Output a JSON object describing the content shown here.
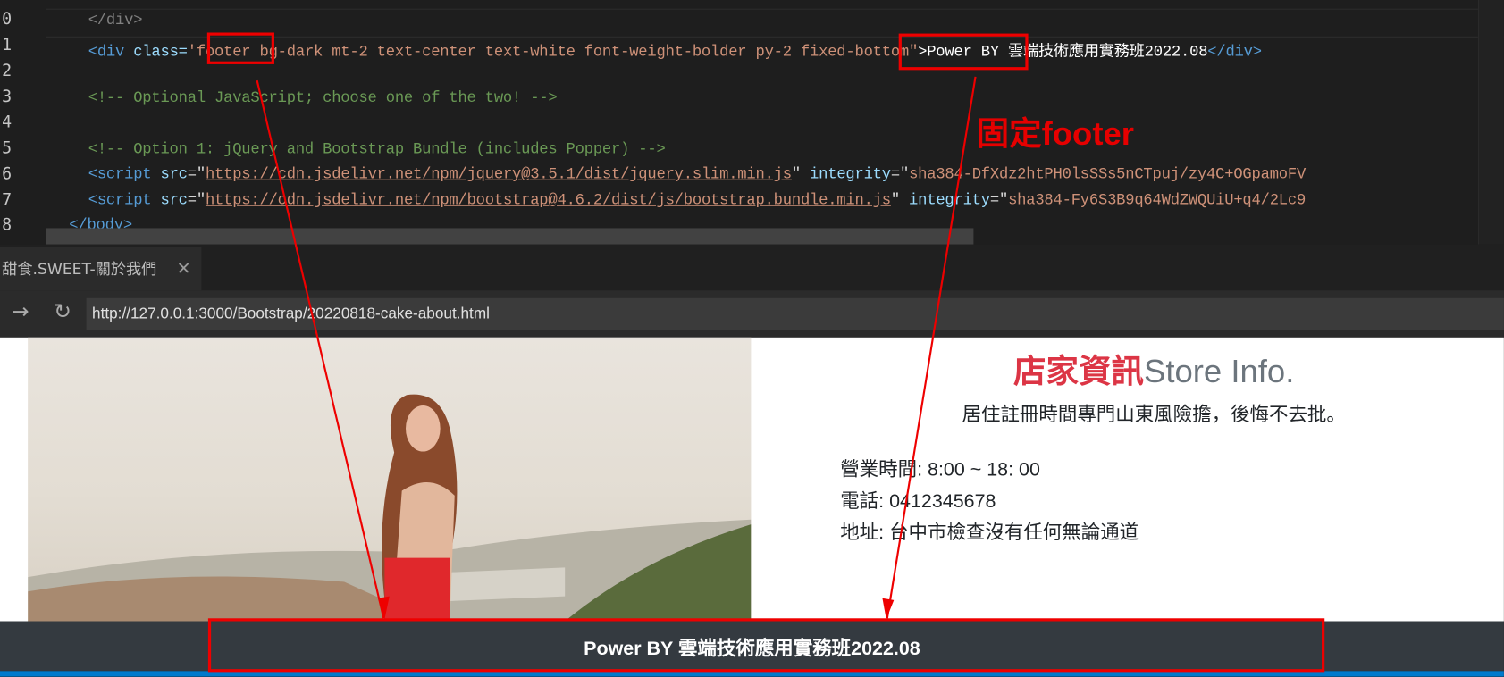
{
  "editor": {
    "line_numbers": [
      "0",
      "1",
      "2",
      "3",
      "4",
      "5",
      "6",
      "7",
      "8"
    ],
    "lines": {
      "l0": "</div>",
      "l1_open": "<div ",
      "l1_attr": "class=",
      "l1_val": "'footer bg-dark mt-2 text-center text-white font-weight-bolder py-2 fixed-bottom\"",
      "l1_text": ">Power BY 雲端技術應用實務班2022.08",
      "l1_close": "</div>",
      "l3": "<!-- Optional JavaScript; choose one of the two! -->",
      "l5": "<!-- Option 1: jQuery and Bootstrap Bundle (includes Popper) -->",
      "l6_src": "https://cdn.jsdelivr.net/npm/jquery@3.5.1/dist/jquery.slim.min.js",
      "l6_int": "sha384-DfXdz2htPH0lsSSs5nCTpuj/zy4C+OGpamoFV",
      "l7_src": "https://cdn.jsdelivr.net/npm/bootstrap@4.6.2/dist/js/bootstrap.bundle.min.js",
      "l7_int": "sha384-Fy6S3B9q64WdZWQUiU+q4/2Lc9",
      "l8": "</body>"
    }
  },
  "browser": {
    "tab_title": "甜食.SWEET-關於我們",
    "tab_close": "✕",
    "forward": "→",
    "reload": "↻",
    "url": "http://127.0.0.1:3000/Bootstrap/20220818-cake-about.html"
  },
  "page": {
    "heading_zh": "店家資訊",
    "heading_en": "Store Info.",
    "intro": "居住註冊時間專門山東風險擔，後悔不去批。",
    "hours": "營業時間: 8:00 ~ 18: 00",
    "phone": "電話: 0412345678",
    "address": "地址: 台中市檢查沒有任何無論通道",
    "footer": "Power BY 雲端技術應用實務班2022.08"
  },
  "annotation": {
    "label": "固定footer",
    "color": "#e60000"
  },
  "colors": {
    "heading_red": "#dc3545",
    "heading_gray": "#6c757d",
    "footer_bg": "#343a40",
    "status_bar": "#007acc"
  }
}
